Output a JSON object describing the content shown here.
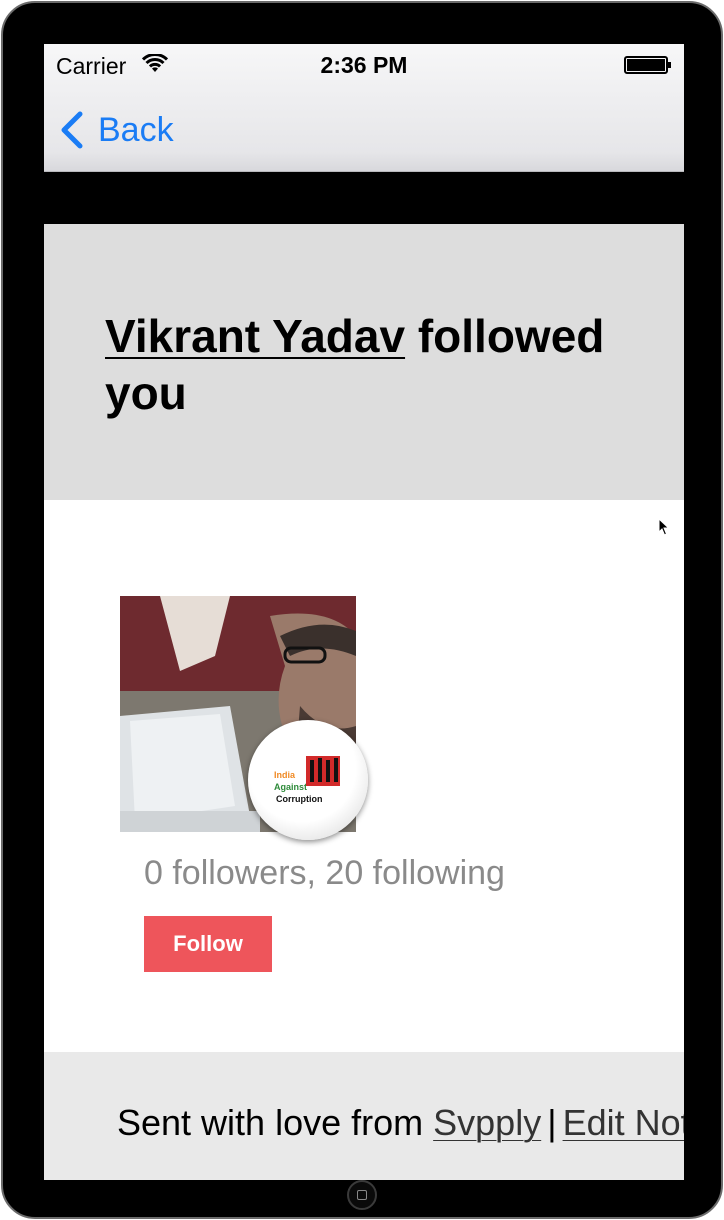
{
  "status_bar": {
    "carrier": "Carrier",
    "time": "2:36 PM"
  },
  "nav": {
    "back_label": "Back"
  },
  "notification": {
    "user_name": "Vikrant Yadav",
    "action_text": "followed you"
  },
  "profile": {
    "stats": "0 followers, 20 following",
    "follow_label": "Follow",
    "badge_text_lines": [
      "India",
      "Against",
      "Corruption"
    ]
  },
  "footer": {
    "sent_text": "Sent with love from",
    "brand_link": "Svpply",
    "separator": "|",
    "edit_link": "Edit Notifications"
  },
  "colors": {
    "ios_blue": "#1a7cf5",
    "follow_red": "#ee555b",
    "banner_gray": "#dddddd",
    "footer_gray": "#e9e9e9"
  },
  "icons": [
    "wifi-icon",
    "battery-icon",
    "chevron-left-icon",
    "cursor-icon",
    "home-button-icon"
  ]
}
